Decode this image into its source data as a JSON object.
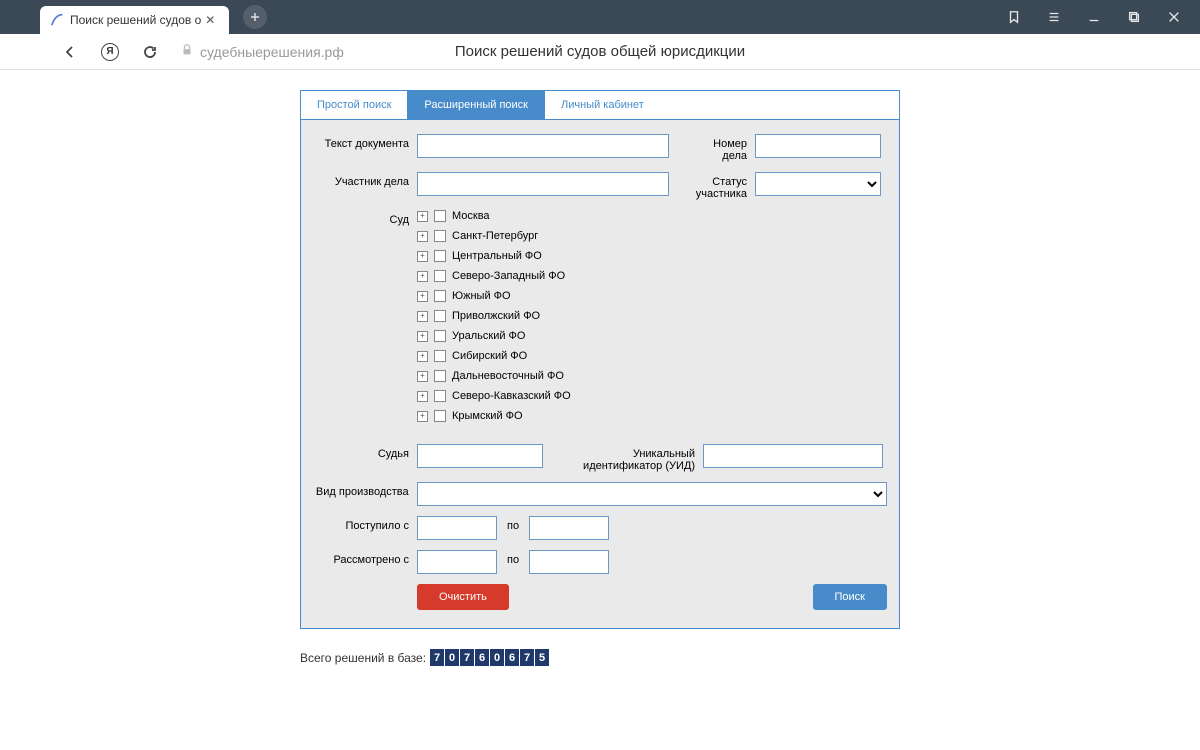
{
  "browser": {
    "tab_title": "Поиск решений судов о",
    "url": "судебныерешения.рф",
    "page_header": "Поиск решений судов общей юрисдикции"
  },
  "nav_tabs": {
    "simple": "Простой поиск",
    "advanced": "Расширенный поиск",
    "cabinet": "Личный кабинет"
  },
  "labels": {
    "doc_text": "Текст документа",
    "case_number": "Номер дела",
    "participant": "Участник дела",
    "participant_status": "Статус участника",
    "court": "Суд",
    "judge": "Судья",
    "uid": "Уникальный идентификатор (УИД)",
    "proceeding_type": "Вид производства",
    "received_from": "Поступило с",
    "reviewed_from": "Рассмотрено с",
    "to": "по"
  },
  "court_tree": [
    "Москва",
    "Санкт-Петербург",
    "Центральный ФО",
    "Северо-Западный ФО",
    "Южный ФО",
    "Приволжский ФО",
    "Уральский ФО",
    "Сибирский ФО",
    "Дальневосточный ФО",
    "Северо-Кавказский ФО",
    "Крымский ФО"
  ],
  "buttons": {
    "clear": "Очистить",
    "search": "Поиск"
  },
  "totals": {
    "label": "Всего решений в базе:",
    "digits": [
      "7",
      "0",
      "7",
      "6",
      "0",
      "6",
      "7",
      "5"
    ]
  }
}
